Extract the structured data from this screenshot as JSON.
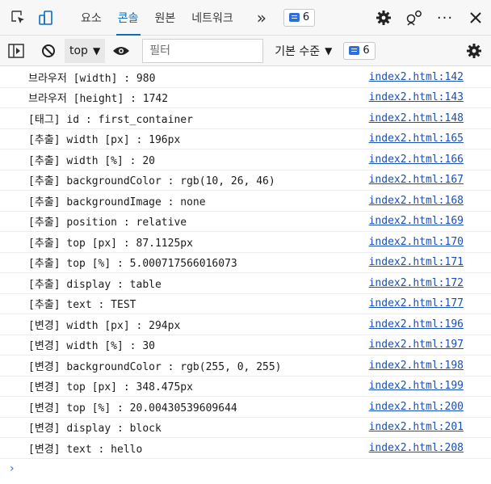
{
  "tabs": [
    {
      "label": "요소",
      "active": false
    },
    {
      "label": "콘솔",
      "active": true
    },
    {
      "label": "원본",
      "active": false
    },
    {
      "label": "네트워크",
      "active": false
    }
  ],
  "more_tabs_symbol": "»",
  "issues_count": "6",
  "toolbar": {
    "context": "top",
    "context_arrow": "▼",
    "filter_placeholder": "필터",
    "levels_label": "기본 수준",
    "levels_arrow": "▼",
    "message_count": "6"
  },
  "accent_color": "#0f6cbd",
  "link_color": "#1a4fb5",
  "logs": [
    {
      "text": "브라우저 [width] : 980",
      "source": "index2.html:142"
    },
    {
      "text": "브라우저 [height] : 1742",
      "source": "index2.html:143"
    },
    {
      "text": "[태그] id : first_container",
      "source": "index2.html:148"
    },
    {
      "text": "[추출] width [px] : 196px",
      "source": "index2.html:165"
    },
    {
      "text": "[추출] width [%] : 20",
      "source": "index2.html:166"
    },
    {
      "text": "[추출] backgroundColor : rgb(10, 26, 46)",
      "source": "index2.html:167"
    },
    {
      "text": "[추출] backgroundImage : none",
      "source": "index2.html:168"
    },
    {
      "text": "[추출] position : relative",
      "source": "index2.html:169"
    },
    {
      "text": "[추출] top [px] : 87.1125px",
      "source": "index2.html:170"
    },
    {
      "text": "[추출] top [%] : 5.000717566016073",
      "source": "index2.html:171"
    },
    {
      "text": "[추출] display : table",
      "source": "index2.html:172"
    },
    {
      "text": "[추출] text : TEST",
      "source": "index2.html:177"
    },
    {
      "text": "[변경] width [px] : 294px",
      "source": "index2.html:196"
    },
    {
      "text": "[변경] width [%] : 30",
      "source": "index2.html:197"
    },
    {
      "text": "[변경] backgroundColor : rgb(255, 0, 255)",
      "source": "index2.html:198"
    },
    {
      "text": "[변경] top [px] : 348.475px",
      "source": "index2.html:199"
    },
    {
      "text": "[변경] top [%] : 20.00430539609644",
      "source": "index2.html:200"
    },
    {
      "text": "[변경] display : block",
      "source": "index2.html:201"
    },
    {
      "text": "[변경] text : hello",
      "source": "index2.html:208"
    }
  ],
  "prompt_symbol": "›"
}
